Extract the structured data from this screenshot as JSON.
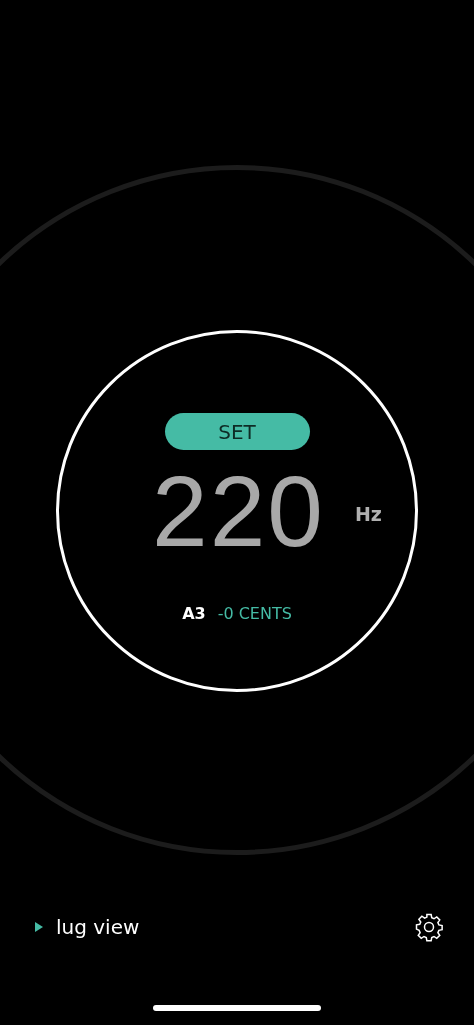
{
  "set_button": {
    "label": "SET"
  },
  "frequency": {
    "value": "220",
    "unit": "Hz"
  },
  "pitch": {
    "note": "A3",
    "cents": "-0 CENTS"
  },
  "lug_view": {
    "label": "lug view",
    "expanded": false
  }
}
